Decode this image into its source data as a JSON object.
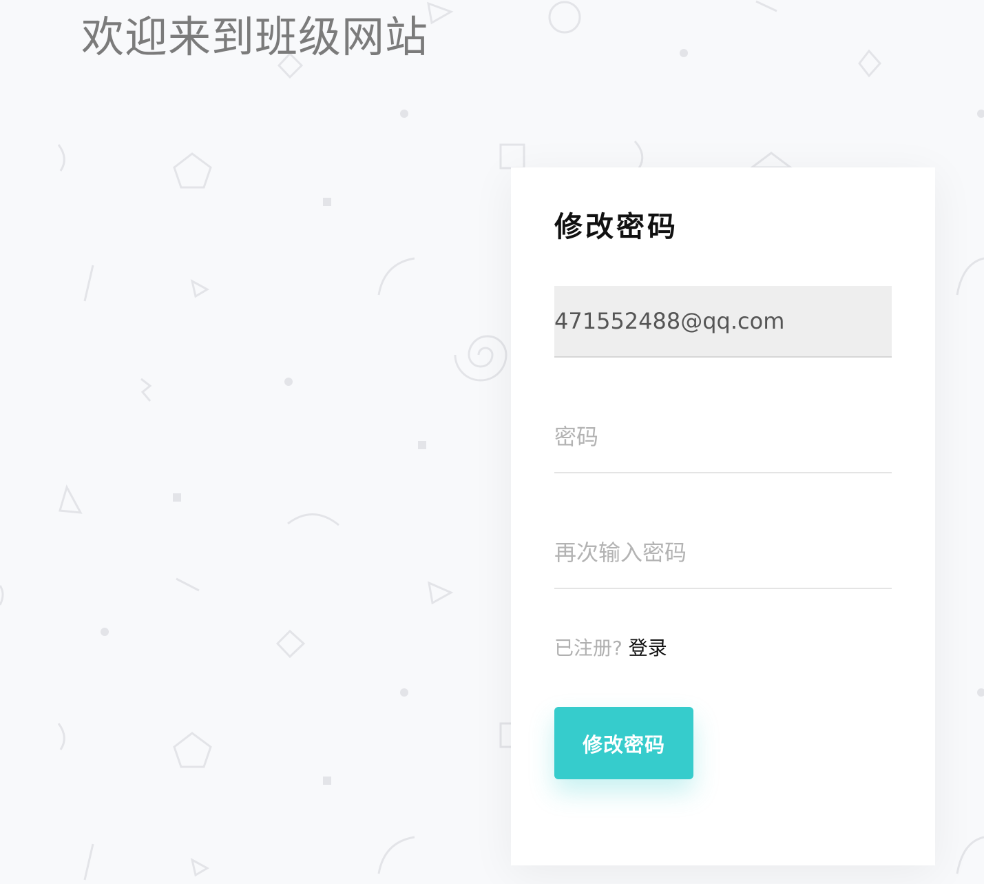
{
  "header": {
    "site_title": "欢迎来到班级网站"
  },
  "form": {
    "title": "修改密码",
    "email": {
      "value": "471552488@qq.com",
      "placeholder": ""
    },
    "password": {
      "value": "",
      "placeholder": "密码"
    },
    "confirm_password": {
      "value": "",
      "placeholder": "再次输入密码"
    },
    "login_prompt": "已注册?",
    "login_link": "登录",
    "submit_label": "修改密码"
  },
  "colors": {
    "background": "#f8f9fb",
    "accent": "#36cccc",
    "card": "#ffffff",
    "title_text": "#7b7b7b"
  }
}
